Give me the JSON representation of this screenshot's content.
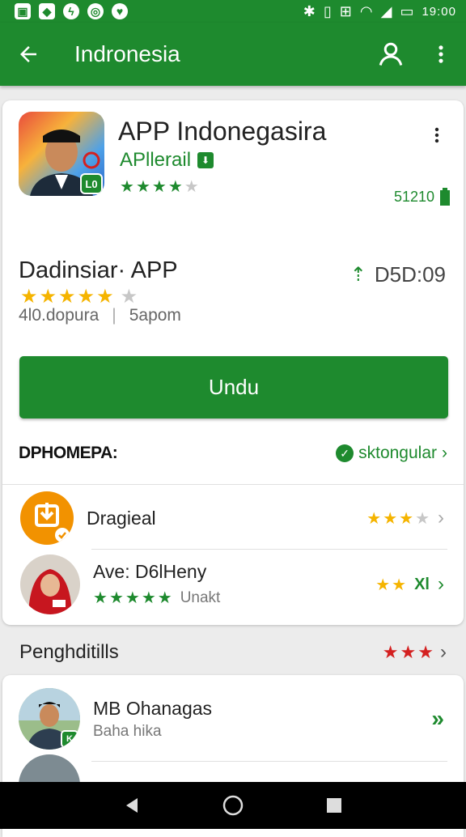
{
  "status_bar": {
    "time": "19:00",
    "left_icons": [
      "image-icon",
      "notification-icon",
      "messenger-icon",
      "chrome-icon",
      "heart-icon"
    ],
    "right_icons": [
      "bluetooth-icon",
      "vibrate-icon",
      "signal-icon",
      "wifi-icon",
      "battery-icon"
    ]
  },
  "app_bar": {
    "title": "Indronesia"
  },
  "app": {
    "name": "APP Indonegasira",
    "developer": "APllerail",
    "rating_stars": 4.5,
    "size": "51210",
    "icon_badge": "L0"
  },
  "details": {
    "title": "Dadinsiar· APP",
    "timer": "D5D:09",
    "rating_stars": 5,
    "downloads": "4l0.dopura",
    "separator": "|",
    "info": "5apom"
  },
  "install_button": {
    "label": "Undu"
  },
  "section": {
    "heading": "DPHOMEPA:",
    "link": "sktongular"
  },
  "items": [
    {
      "name": "Dragieal",
      "sub": "",
      "stars": 3.5,
      "star_color": "yellow"
    },
    {
      "name": "Ave: D6lHeny",
      "sub": "Unakt",
      "stars": 5,
      "star_color": "green",
      "right_text": "Xl"
    }
  ],
  "section2": {
    "heading": "Penghditills",
    "stars": 3
  },
  "list2": [
    {
      "name": "MB Ohanagas",
      "sub": "Baha hika",
      "badge": "K"
    }
  ],
  "colors": {
    "primary": "#1e8a2e",
    "star_yellow": "#f5b400",
    "star_red": "#d42020",
    "orange": "#f29200"
  }
}
